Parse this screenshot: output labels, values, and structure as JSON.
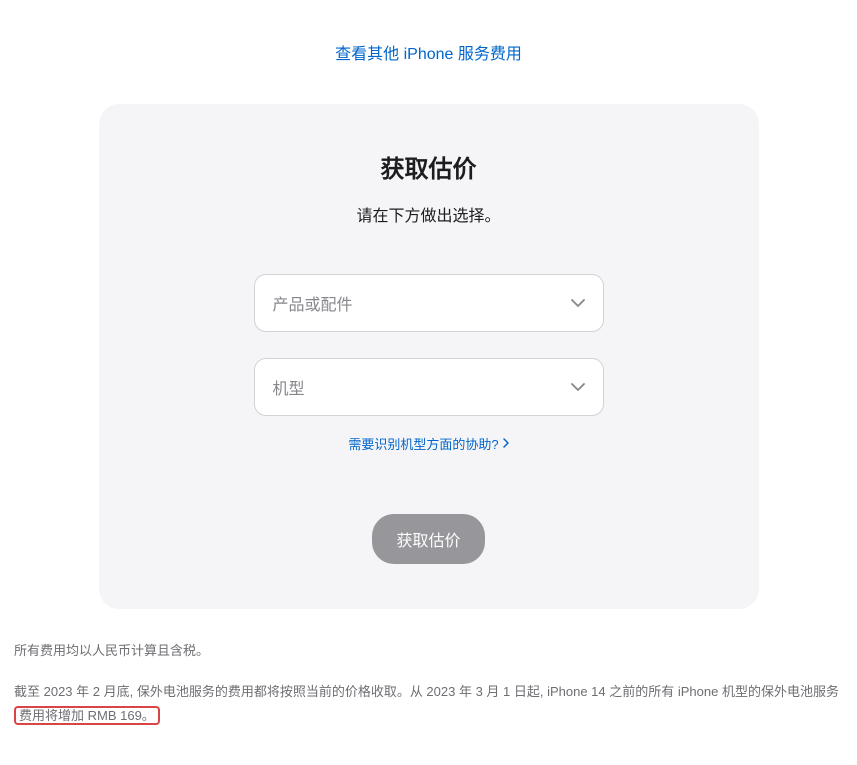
{
  "top_link": "查看其他 iPhone 服务费用",
  "card": {
    "title": "获取估价",
    "subtitle": "请在下方做出选择。",
    "select1_placeholder": "产品或配件",
    "select2_placeholder": "机型",
    "help_link": "需要识别机型方面的协助?",
    "submit_label": "获取估价"
  },
  "footer": {
    "line1": "所有费用均以人民币计算且含税。",
    "line2_prefix": "截至 2023 年 2 月底, 保外电池服务的费用都将按照当前的价格收取。从 2023 年 3 月 1 日起, iPhone 14 之前的所有 iPhone 机型的保外电池服务",
    "line2_highlight": "费用将增加 RMB 169。"
  }
}
